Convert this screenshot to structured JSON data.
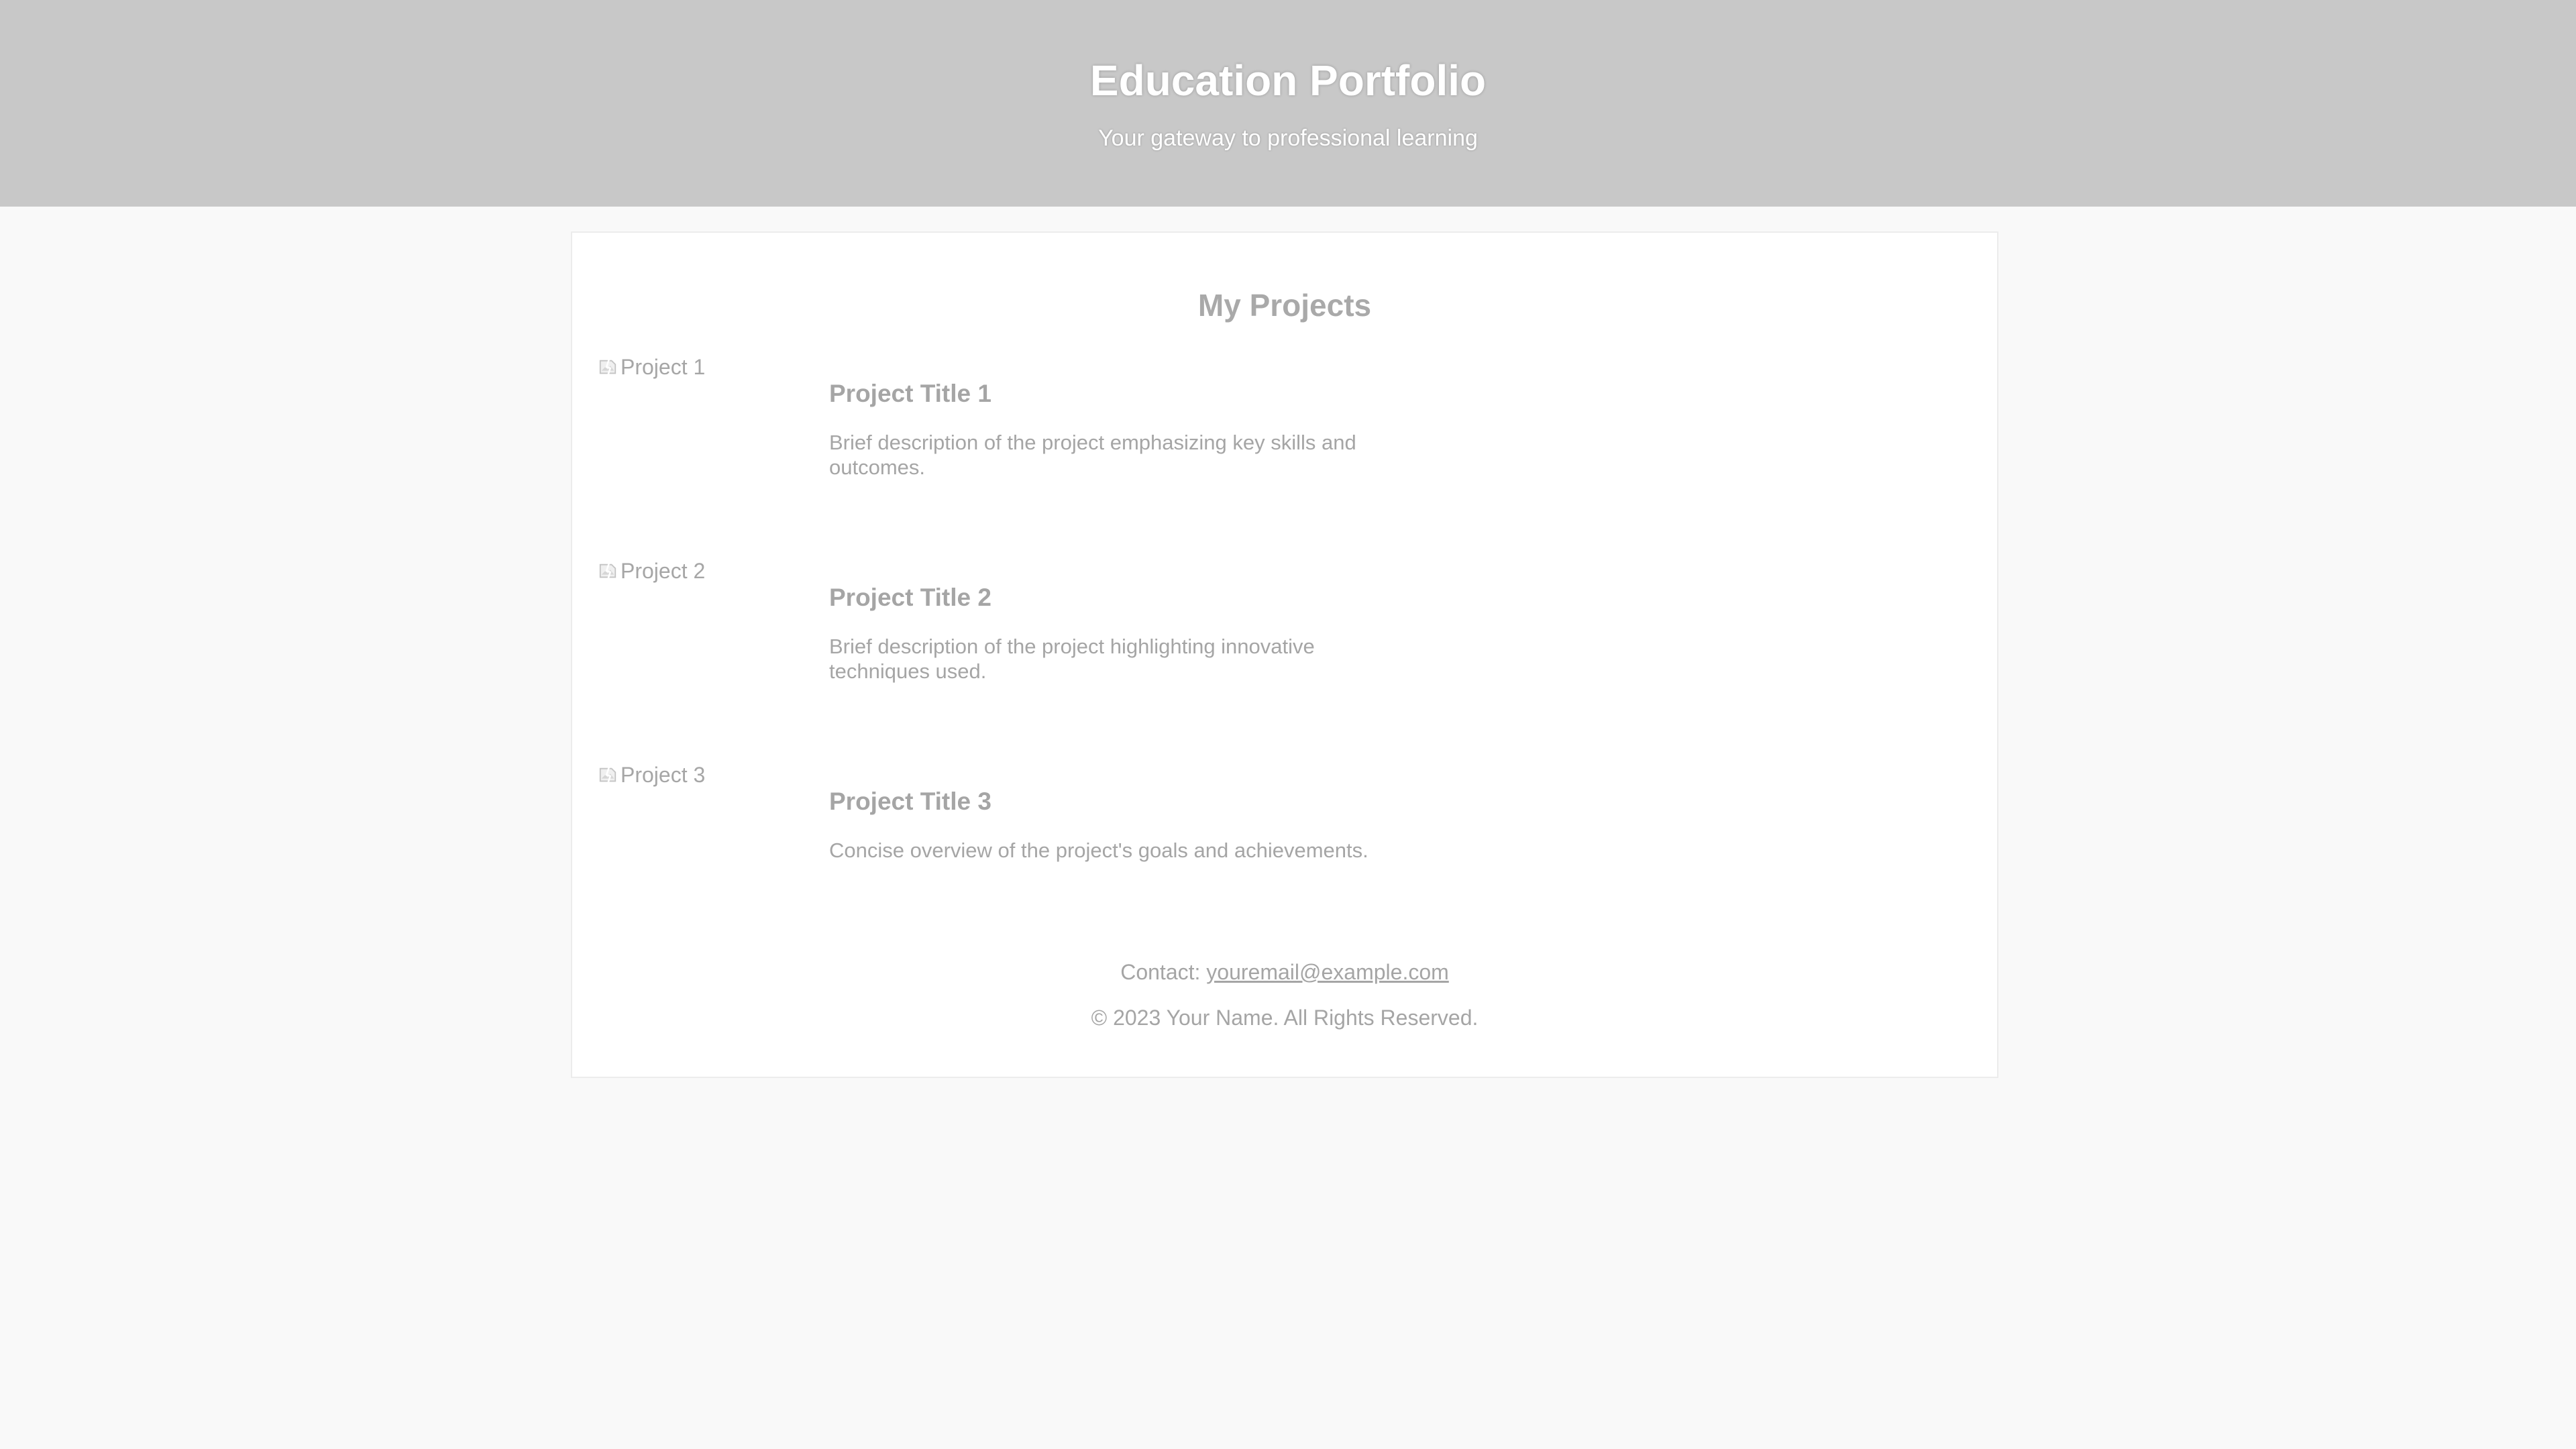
{
  "header": {
    "title": "Education Portfolio",
    "subtitle": "Your gateway to professional learning"
  },
  "main": {
    "section_title": "My Projects",
    "projects": [
      {
        "image_alt": "Project 1",
        "title": "Project Title 1",
        "description": "Brief description of the project emphasizing key skills and outcomes."
      },
      {
        "image_alt": "Project 2",
        "title": "Project Title 2",
        "description": "Brief description of the project highlighting innovative techniques used."
      },
      {
        "image_alt": "Project 3",
        "title": "Project Title 3",
        "description": "Concise overview of the project's goals and achievements."
      }
    ]
  },
  "footer": {
    "contact_label": "Contact:",
    "email": "youremail@example.com",
    "copyright": "© 2023 Your Name. All Rights Reserved."
  },
  "icons": {
    "broken_image": "broken-image-icon"
  },
  "colors": {
    "header_bg": "#c8c8c8",
    "page_bg": "#f9f9f9",
    "card_bg": "#ffffff",
    "text_muted": "#a5a5a5"
  }
}
